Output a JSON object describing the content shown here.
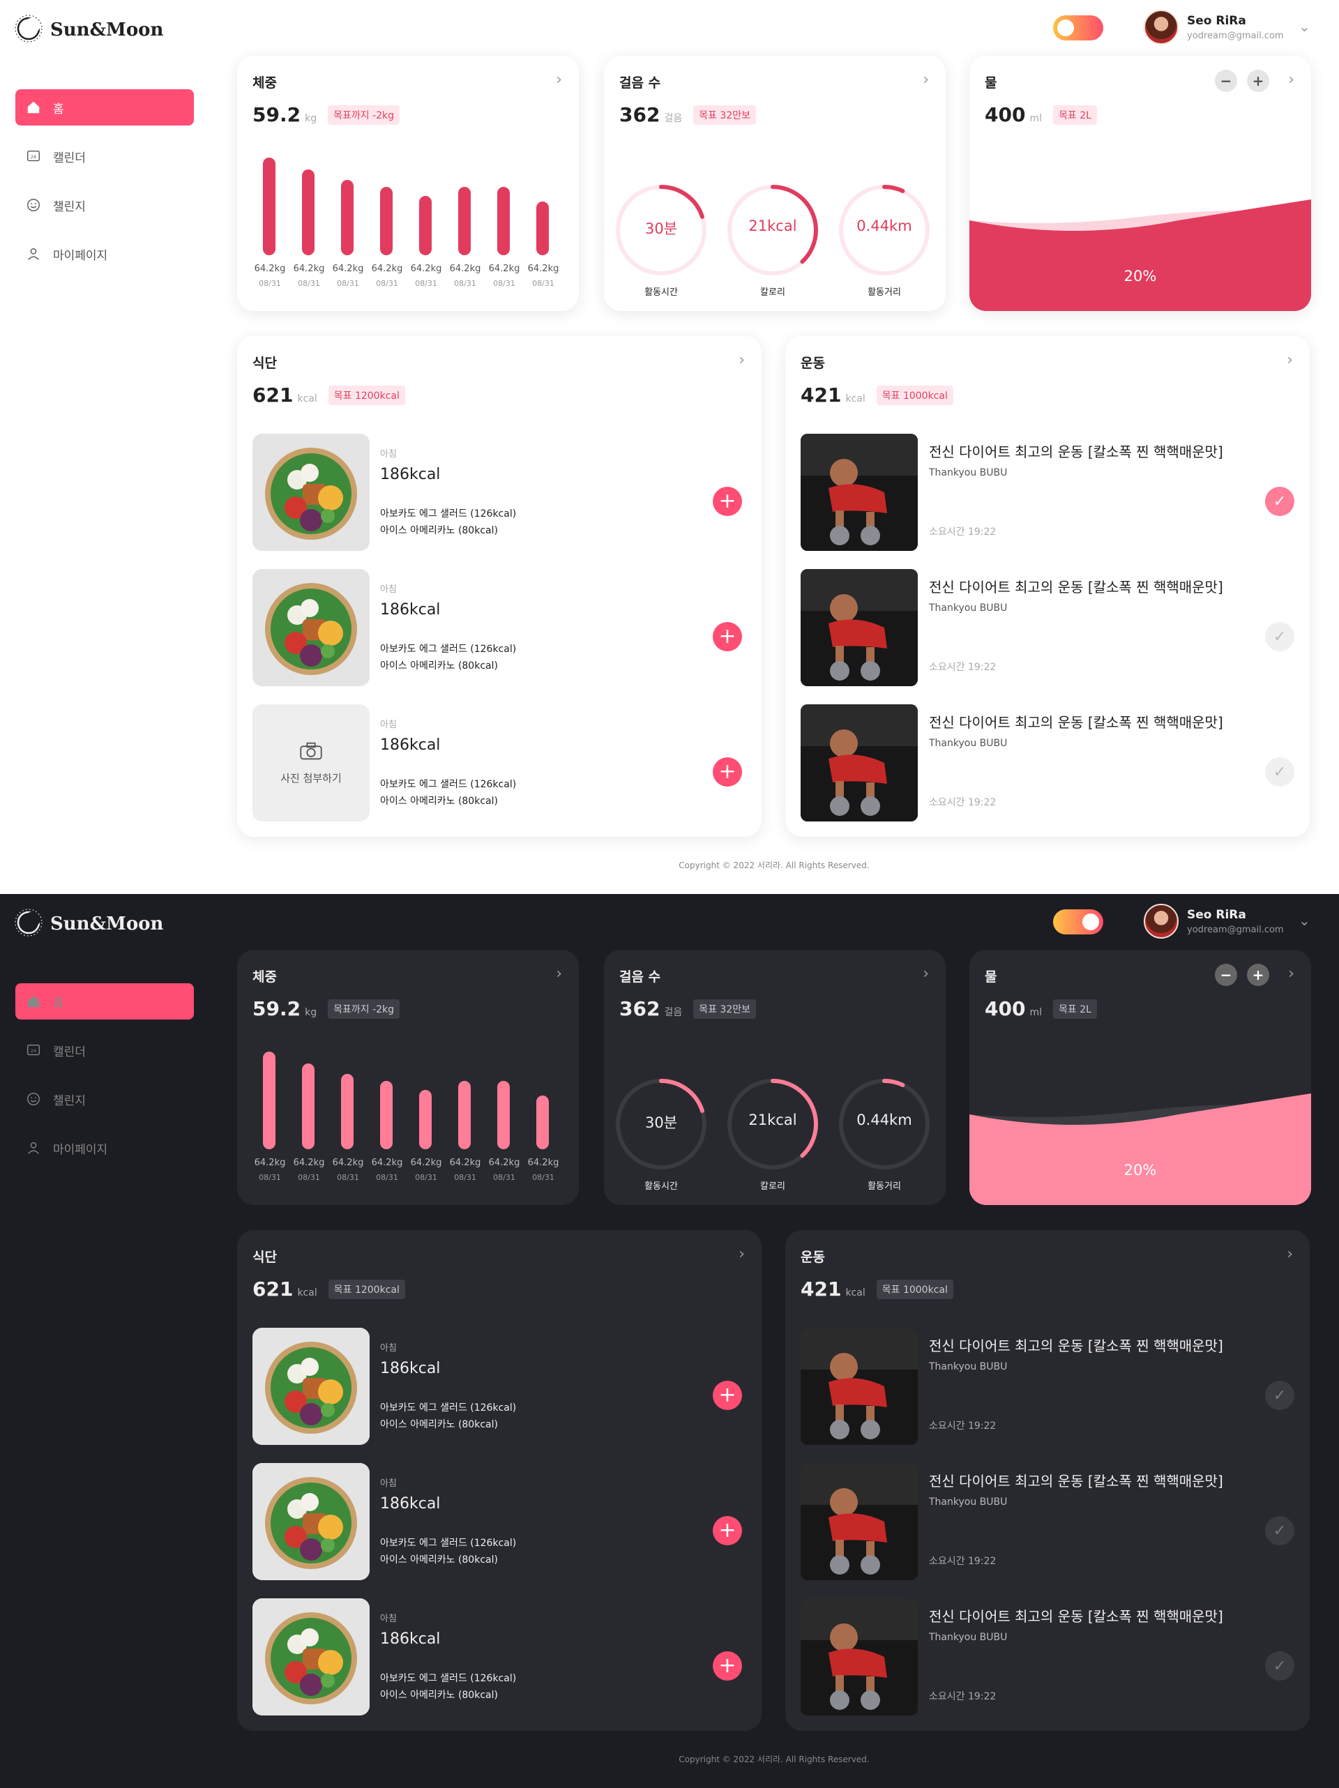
{
  "brand": {
    "name": "Sun&Moon"
  },
  "user": {
    "name": "Seo RiRa",
    "email": "yodream@gmail.com"
  },
  "nav": [
    {
      "label": "홈",
      "icon": "home-icon"
    },
    {
      "label": "캘린더",
      "icon": "calendar-icon"
    },
    {
      "label": "챌린지",
      "icon": "smile-icon"
    },
    {
      "label": "마이페이지",
      "icon": "user-icon"
    }
  ],
  "weight": {
    "title": "체중",
    "value": "59.2",
    "unit": "kg",
    "goal": "목표까지 -2kg",
    "bars": [
      {
        "label": "64.2kg",
        "date": "08/31",
        "level": 1.0
      },
      {
        "label": "64.2kg",
        "date": "08/31",
        "level": 0.88
      },
      {
        "label": "64.2kg",
        "date": "08/31",
        "level": 0.77
      },
      {
        "label": "64.2kg",
        "date": "08/31",
        "level": 0.7
      },
      {
        "label": "64.2kg",
        "date": "08/31",
        "level": 0.61
      },
      {
        "label": "64.2kg",
        "date": "08/31",
        "level": 0.7
      },
      {
        "label": "64.2kg",
        "date": "08/31",
        "level": 0.7
      },
      {
        "label": "64.2kg",
        "date": "08/31",
        "level": 0.55
      }
    ]
  },
  "steps": {
    "title": "걸음 수",
    "value": "362",
    "unit": "걸음",
    "goal": "목표 32만보",
    "rings": [
      {
        "value": "30분",
        "caption": "활동시간",
        "progress": 0.2
      },
      {
        "value": "21kcal",
        "caption": "칼로리",
        "progress": 0.38
      },
      {
        "value": "0.44km",
        "caption": "활동거리",
        "progress": 0.07
      }
    ]
  },
  "water": {
    "title": "물",
    "value": "400",
    "unit": "ml",
    "goal": "목표 2L",
    "percent": "20%"
  },
  "diet": {
    "title": "식단",
    "value": "621",
    "unit": "kcal",
    "goal": "목표 1200kcal",
    "photo_label": "사진 첨부하기",
    "meals": [
      {
        "tag": "아침",
        "kcal": "186kcal",
        "item1": "아보카도 에그 샐러드 (126kcal)",
        "item2": "아이스 아메리카노 (80kcal)"
      },
      {
        "tag": "아침",
        "kcal": "186kcal",
        "item1": "아보카도 에그 샐러드 (126kcal)",
        "item2": "아이스 아메리카노 (80kcal)"
      },
      {
        "tag": "아침",
        "kcal": "186kcal",
        "item1": "아보카도 에그 샐러드 (126kcal)",
        "item2": "아이스 아메리카노 (80kcal)"
      }
    ]
  },
  "exercise": {
    "title": "운동",
    "value": "421",
    "unit": "kcal",
    "goal": "목표 1000kcal",
    "items": [
      {
        "title": "전신 다이어트 최고의 운동 [칼소폭 찐 핵핵매운맛]",
        "channel": "Thankyou BUBU",
        "time": "소요시간 19:22",
        "done": true
      },
      {
        "title": "전신 다이어트 최고의 운동 [칼소폭 찐 핵핵매운맛]",
        "channel": "Thankyou BUBU",
        "time": "소요시간 19:22",
        "done": false
      },
      {
        "title": "전신 다이어트 최고의 운동 [칼소폭 찐 핵핵매운맛]",
        "channel": "Thankyou BUBU",
        "time": "소요시간 19:22",
        "done": false
      }
    ]
  },
  "copyright": "Copyright © 2022 서리라. All Rights Reserved.",
  "colors": {
    "accent": "#ff4d74",
    "accent_dark": "#e13c5e",
    "dark_bg": "#1c1d22",
    "dark_card": "#28292f"
  }
}
